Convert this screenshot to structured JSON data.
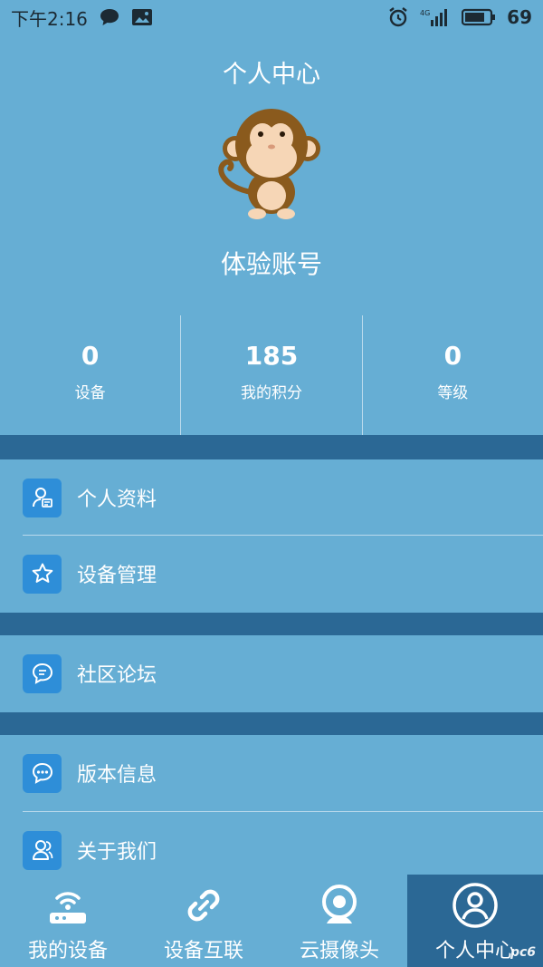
{
  "status_bar": {
    "time": "下午2:16",
    "network": "4G",
    "battery": "69"
  },
  "header": {
    "title": "个人中心",
    "account_name": "体验账号"
  },
  "stats": [
    {
      "value": "0",
      "label": "设备"
    },
    {
      "value": "185",
      "label": "我的积分"
    },
    {
      "value": "0",
      "label": "等级"
    }
  ],
  "menu": {
    "profile": "个人资料",
    "device_manage": "设备管理",
    "forum": "社区论坛",
    "version": "版本信息",
    "about": "关于我们"
  },
  "bottom_nav": [
    {
      "label": "我的设备",
      "icon": "router-icon",
      "active": false
    },
    {
      "label": "设备互联",
      "icon": "link-icon",
      "active": false
    },
    {
      "label": "云摄像头",
      "icon": "camera-icon",
      "active": false
    },
    {
      "label": "个人中心",
      "icon": "user-icon",
      "active": true
    }
  ],
  "watermark": "pc6",
  "colors": {
    "background": "#66aed4",
    "separator": "#2b6895",
    "icon_tile": "#2e8ed8"
  }
}
